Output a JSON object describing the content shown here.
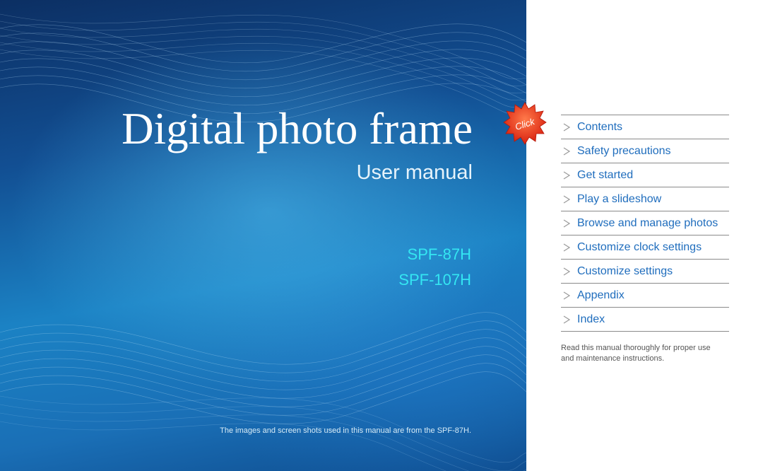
{
  "cover": {
    "title": "Digital photo frame",
    "subtitle": "User manual",
    "models": [
      "SPF-87H",
      "SPF-107H"
    ],
    "footnote": "The images and screen shots used in this manual are from the SPF-87H.",
    "colors": {
      "background": "#1a6fb6",
      "model_text": "#34e6f2"
    }
  },
  "click_badge": {
    "label": "Click",
    "color": "#e8321e"
  },
  "nav": {
    "items": [
      {
        "label": "Contents"
      },
      {
        "label": "Safety precautions"
      },
      {
        "label": "Get started"
      },
      {
        "label": "Play a slideshow"
      },
      {
        "label": "Browse and manage photos"
      },
      {
        "label": "Customize clock settings"
      },
      {
        "label": "Customize settings"
      },
      {
        "label": "Appendix"
      },
      {
        "label": "Index"
      }
    ],
    "link_color": "#1f6dbd"
  },
  "note": "Read this manual thoroughly for proper use and maintenance instructions."
}
